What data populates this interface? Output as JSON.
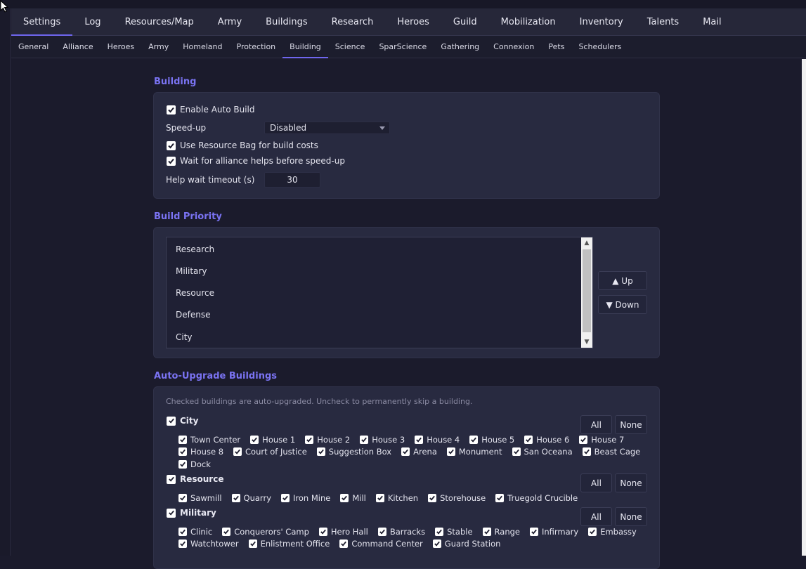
{
  "main_tabs": [
    {
      "label": "Settings",
      "active": true
    },
    {
      "label": "Log"
    },
    {
      "label": "Resources/Map"
    },
    {
      "label": "Army"
    },
    {
      "label": "Buildings"
    },
    {
      "label": "Research"
    },
    {
      "label": "Heroes"
    },
    {
      "label": "Guild"
    },
    {
      "label": "Mobilization"
    },
    {
      "label": "Inventory"
    },
    {
      "label": "Talents"
    },
    {
      "label": "Mail"
    }
  ],
  "sub_tabs": [
    {
      "label": "General"
    },
    {
      "label": "Alliance"
    },
    {
      "label": "Heroes"
    },
    {
      "label": "Army"
    },
    {
      "label": "Homeland"
    },
    {
      "label": "Protection"
    },
    {
      "label": "Building",
      "active": true
    },
    {
      "label": "Science"
    },
    {
      "label": "SparScience"
    },
    {
      "label": "Gathering"
    },
    {
      "label": "Connexion"
    },
    {
      "label": "Pets"
    },
    {
      "label": "Schedulers"
    }
  ],
  "building": {
    "title": "Building",
    "enable_auto_build": {
      "label": "Enable Auto Build",
      "checked": true
    },
    "speedup": {
      "label": "Speed-up",
      "value": "Disabled"
    },
    "use_resource_bag": {
      "label": "Use Resource Bag for build costs",
      "checked": true
    },
    "wait_alliance_helps": {
      "label": "Wait for alliance helps before speed-up",
      "checked": true
    },
    "help_wait_timeout": {
      "label": "Help wait timeout (s)",
      "value": "30"
    }
  },
  "build_priority": {
    "title": "Build Priority",
    "items": [
      "Research",
      "Military",
      "Resource",
      "Defense",
      "City"
    ],
    "up_label": "▲ Up",
    "down_label": "▼ Down"
  },
  "auto_upgrade": {
    "title": "Auto-Upgrade Buildings",
    "hint": "Checked buildings are auto-upgraded. Uncheck to permanently skip a building.",
    "all_label": "All",
    "none_label": "None",
    "groups": [
      {
        "name": "City",
        "checked": true,
        "rows": [
          [
            "Town Center",
            "House 1",
            "House 2",
            "House 3",
            "House 4",
            "House 5",
            "House 6",
            "House 7"
          ],
          [
            "House 8",
            "Court of Justice",
            "Suggestion Box",
            "Arena",
            "Monument",
            "San Oceana",
            "Beast Cage"
          ],
          [
            "Dock"
          ]
        ]
      },
      {
        "name": "Resource",
        "checked": true,
        "rows": [
          [
            "Sawmill",
            "Quarry",
            "Iron Mine",
            "Mill",
            "Kitchen",
            "Storehouse",
            "Truegold Crucible"
          ]
        ]
      },
      {
        "name": "Military",
        "checked": true,
        "rows": [
          [
            "Clinic",
            "Conquerors' Camp",
            "Hero Hall",
            "Barracks",
            "Stable",
            "Range",
            "Infirmary",
            "Embassy"
          ],
          [
            "Watchtower",
            "Enlistment Office",
            "Command Center",
            "Guard Station"
          ]
        ]
      }
    ]
  },
  "colors": {
    "accent": "#6f66ee",
    "section_title": "#7a73f2",
    "background": "#1b1b2c",
    "panel": "#282a40"
  }
}
